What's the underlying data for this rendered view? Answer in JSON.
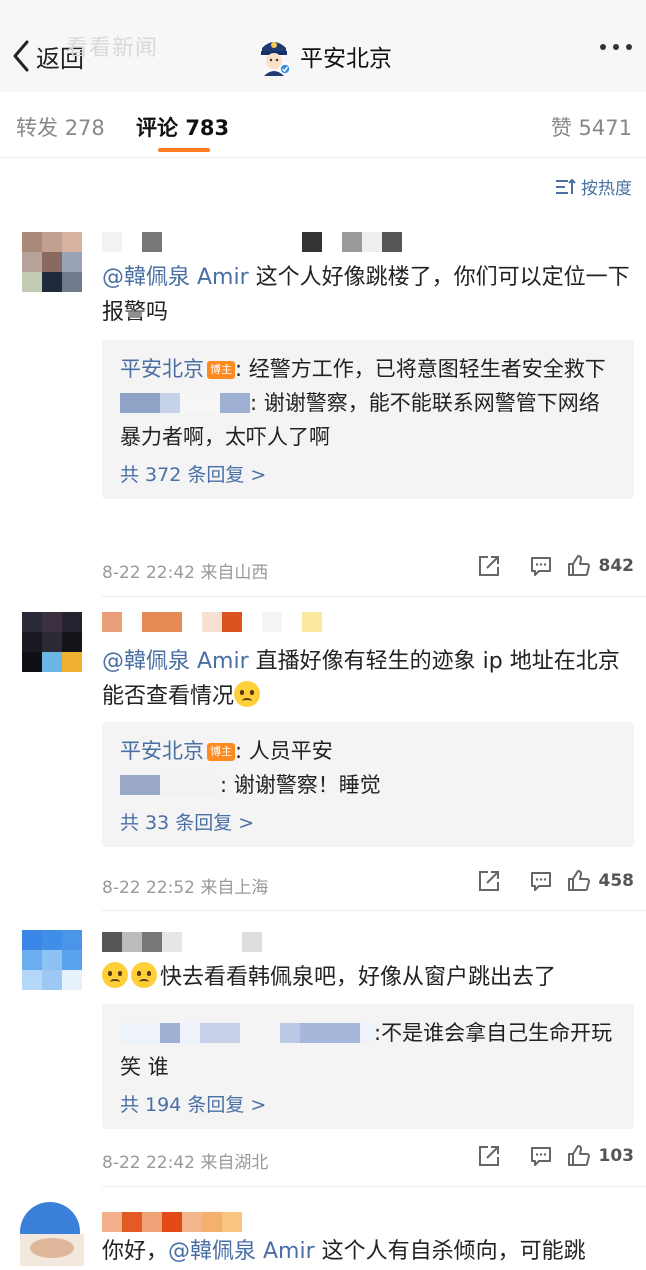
{
  "nav": {
    "back_label": "返回",
    "watermark": "看看新闻",
    "title": "平安北京"
  },
  "tabs": {
    "repost_label": "转发",
    "repost_count": "278",
    "comment_label": "评论",
    "comment_count": "783",
    "like_label": "赞",
    "like_count": "5471"
  },
  "sort_label": "按热度",
  "colors": {
    "accent": "#ff7a21",
    "link": "#4a6fa5",
    "reply_bg": "#f4f4f4",
    "blogger_tag": "#ff8a1f"
  },
  "comments": [
    {
      "mention": "@韓佩泉 Amir",
      "text_after": " 这个人好像跳楼了，你们可以定位一下报警吗",
      "replies": [
        {
          "author": "平安北京",
          "tag": "博主",
          "text": ": 经警方工作，已将意图轻生者安全救下"
        },
        {
          "author": "",
          "text": ": 谢谢警察，能不能联系网警管下网络暴力者啊，太吓人了啊"
        }
      ],
      "more_replies": "共 372 条回复 >",
      "time": "8-22 22:42",
      "location": "来自山西",
      "likes": "842"
    },
    {
      "mention": "@韓佩泉 Amir",
      "text_after": " 直播好像有轻生的迹象 ip 地址在北京 能否查看情况",
      "emoji": "cry-icon",
      "replies": [
        {
          "author": "平安北京",
          "tag": "博主",
          "text": ": 人员平安"
        },
        {
          "author": "",
          "text": ": 谢谢警察！睡觉"
        }
      ],
      "more_replies": "共 33 条回复 >",
      "time": "8-22 22:52",
      "location": "来自上海",
      "likes": "458"
    },
    {
      "text": "快去看看韩佩泉吧，好像从窗户跳出去了",
      "replies": [
        {
          "author": "",
          "text": ":不是谁会拿自己生命开玩笑 谁"
        }
      ],
      "more_replies": "共 194 条回复 >",
      "time": "8-22 22:42",
      "location": "来自湖北",
      "likes": "103"
    },
    {
      "text_before": "你好，",
      "mention": "@韓佩泉 Amir",
      "text_after": " 这个人有自杀倾向，可能跳"
    }
  ]
}
